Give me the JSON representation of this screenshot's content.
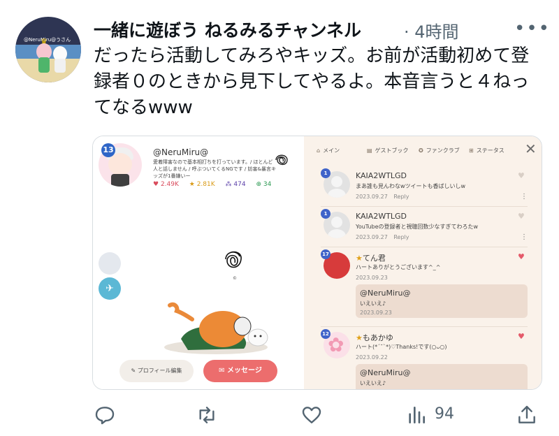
{
  "tweet": {
    "author_name": "一緒に遊ぼう ねるみるチャンネル",
    "time_sep": "·",
    "time": "4時間",
    "more_icon": "more-horizontal-icon",
    "avatar_label": "@NeruMiru@うさん",
    "text": "だったら活動してみろやキッズ。お前が活動初めて登録者０のときから見下してやるよ。本音言うと４ねってなるwww"
  },
  "media": {
    "profile": {
      "level": "13",
      "name": "@NeruMiru@",
      "bio": "愛着障害なので基本相打ちを打っています。/ ほとんど人と話しません / 呼ぶついてくるNGです / 妨害&暴言キッズが1番嫌いー",
      "stats": {
        "hearts": "2.49K",
        "stars": "2.81K",
        "footprints": "474",
        "plus": "34"
      },
      "profile_edit_label": "プロフィール編集",
      "message_label": "メッセージ",
      "scribble_mark": "©"
    },
    "tabs": [
      {
        "label": "メイン",
        "icon": "home-icon"
      },
      {
        "label": "ゲストブック",
        "icon": "book-icon"
      },
      {
        "label": "ファンクラブ",
        "icon": "star-circle-icon"
      },
      {
        "label": "ステータス",
        "icon": "plus-box-icon"
      }
    ],
    "close_icon": "close-icon",
    "entries": [
      {
        "level": "1",
        "name": "KAIA2WTLGD",
        "message": "まあ誰も見んわなwツイートも香ばしいしw",
        "date": "2023.09.27",
        "reply_label": "Reply",
        "liked": false
      },
      {
        "level": "1",
        "name": "KAIA2WTLGD",
        "message": "YouTubeの登録者と視聴回数少なすぎてわろたw",
        "date": "2023.09.27",
        "reply_label": "Reply",
        "liked": false
      },
      {
        "level": "17",
        "name": "てん君",
        "message": "ハートありがとうございます^_^",
        "date": "2023.09.23",
        "liked": true,
        "reply": {
          "name": "@NeruMiru@",
          "message": "いえいえ♪",
          "date": "2023.09.23"
        }
      },
      {
        "level": "12",
        "name": "もあかゆ",
        "message": "ハート(*´˘`*)♡Thanks!です(○ᴗ○)",
        "date": "2023.09.22",
        "liked": true,
        "reply": {
          "name": "@NeruMiru@",
          "message": "いえいえ♪"
        }
      }
    ]
  },
  "actions": {
    "reply_icon": "reply-icon",
    "retweet_icon": "retweet-icon",
    "like_icon": "heart-icon",
    "views_icon": "views-chart-icon",
    "views_count": "94",
    "share_icon": "share-icon"
  },
  "colors": {
    "accent_red": "#ec6d6d",
    "guestbook_bg": "#faf2ea",
    "reply_bg": "#eddcd0",
    "muted_text": "#536471"
  }
}
